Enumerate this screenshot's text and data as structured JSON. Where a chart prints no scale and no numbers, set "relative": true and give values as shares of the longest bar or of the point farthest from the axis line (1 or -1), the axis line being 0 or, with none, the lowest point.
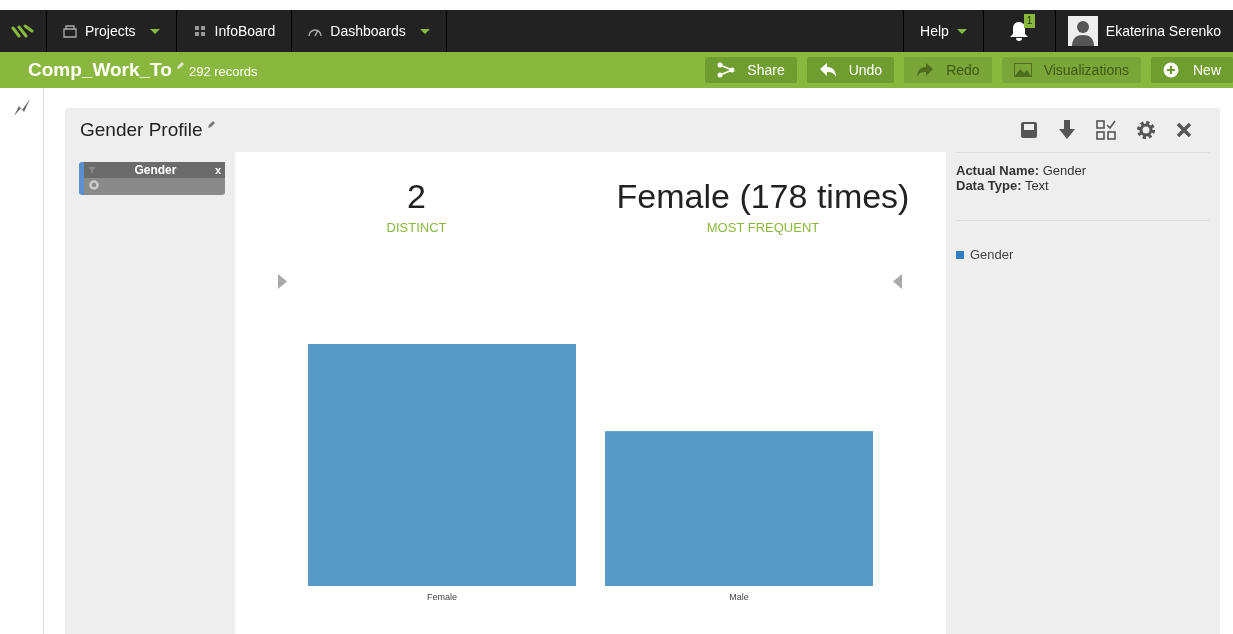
{
  "nav": {
    "items": [
      {
        "label": "Projects",
        "dropdown": true
      },
      {
        "label": "InfoBoard",
        "dropdown": false
      },
      {
        "label": "Dashboards",
        "dropdown": true
      }
    ],
    "help": "Help",
    "notification_count": "1",
    "user": "Ekaterina Serenko"
  },
  "project_bar": {
    "title": "Comp_Work_To",
    "records": "292 records",
    "actions": [
      {
        "label": "Share",
        "disabled": false
      },
      {
        "label": "Undo",
        "disabled": false
      },
      {
        "label": "Redo",
        "disabled": true
      },
      {
        "label": "Visualizations",
        "disabled": true
      },
      {
        "label": "New",
        "disabled": false
      }
    ]
  },
  "panel": {
    "title": "Gender Profile",
    "filter": {
      "label": "Gender",
      "close": "x"
    },
    "stats": [
      {
        "value": "2",
        "caption": "DISTINCT"
      },
      {
        "value": "Female (178 times)",
        "caption": "MOST FREQUENT"
      }
    ],
    "chart_data": {
      "type": "bar",
      "relative": true,
      "categories": [
        "Female",
        "Male"
      ],
      "values": [
        1,
        0.64
      ]
    },
    "info": [
      {
        "key": "Actual Name:",
        "value": "Gender"
      },
      {
        "key": "Data Type:",
        "value": "Text"
      }
    ],
    "legend": [
      {
        "label": "Gender",
        "color": "#2e7fc1"
      }
    ]
  }
}
